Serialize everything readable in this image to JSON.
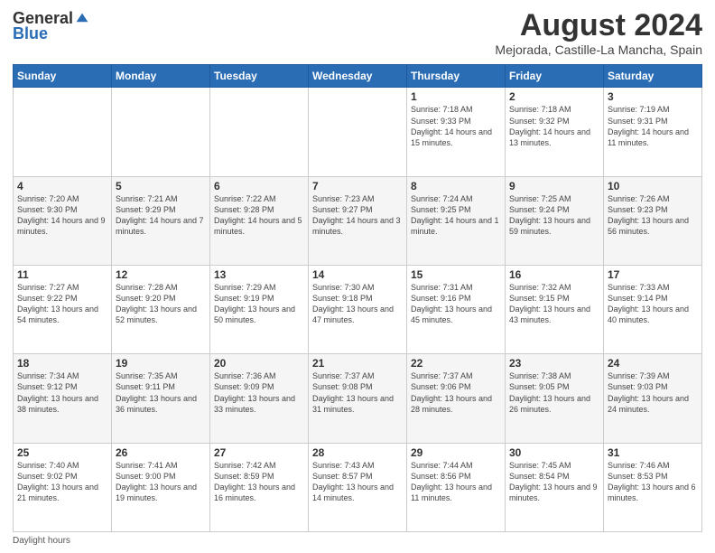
{
  "header": {
    "logo_general": "General",
    "logo_blue": "Blue",
    "title": "August 2024",
    "location": "Mejorada, Castille-La Mancha, Spain"
  },
  "days_of_week": [
    "Sunday",
    "Monday",
    "Tuesday",
    "Wednesday",
    "Thursday",
    "Friday",
    "Saturday"
  ],
  "weeks": [
    [
      {
        "day": "",
        "info": ""
      },
      {
        "day": "",
        "info": ""
      },
      {
        "day": "",
        "info": ""
      },
      {
        "day": "",
        "info": ""
      },
      {
        "day": "1",
        "info": "Sunrise: 7:18 AM\nSunset: 9:33 PM\nDaylight: 14 hours and 15 minutes."
      },
      {
        "day": "2",
        "info": "Sunrise: 7:18 AM\nSunset: 9:32 PM\nDaylight: 14 hours and 13 minutes."
      },
      {
        "day": "3",
        "info": "Sunrise: 7:19 AM\nSunset: 9:31 PM\nDaylight: 14 hours and 11 minutes."
      }
    ],
    [
      {
        "day": "4",
        "info": "Sunrise: 7:20 AM\nSunset: 9:30 PM\nDaylight: 14 hours and 9 minutes."
      },
      {
        "day": "5",
        "info": "Sunrise: 7:21 AM\nSunset: 9:29 PM\nDaylight: 14 hours and 7 minutes."
      },
      {
        "day": "6",
        "info": "Sunrise: 7:22 AM\nSunset: 9:28 PM\nDaylight: 14 hours and 5 minutes."
      },
      {
        "day": "7",
        "info": "Sunrise: 7:23 AM\nSunset: 9:27 PM\nDaylight: 14 hours and 3 minutes."
      },
      {
        "day": "8",
        "info": "Sunrise: 7:24 AM\nSunset: 9:25 PM\nDaylight: 14 hours and 1 minute."
      },
      {
        "day": "9",
        "info": "Sunrise: 7:25 AM\nSunset: 9:24 PM\nDaylight: 13 hours and 59 minutes."
      },
      {
        "day": "10",
        "info": "Sunrise: 7:26 AM\nSunset: 9:23 PM\nDaylight: 13 hours and 56 minutes."
      }
    ],
    [
      {
        "day": "11",
        "info": "Sunrise: 7:27 AM\nSunset: 9:22 PM\nDaylight: 13 hours and 54 minutes."
      },
      {
        "day": "12",
        "info": "Sunrise: 7:28 AM\nSunset: 9:20 PM\nDaylight: 13 hours and 52 minutes."
      },
      {
        "day": "13",
        "info": "Sunrise: 7:29 AM\nSunset: 9:19 PM\nDaylight: 13 hours and 50 minutes."
      },
      {
        "day": "14",
        "info": "Sunrise: 7:30 AM\nSunset: 9:18 PM\nDaylight: 13 hours and 47 minutes."
      },
      {
        "day": "15",
        "info": "Sunrise: 7:31 AM\nSunset: 9:16 PM\nDaylight: 13 hours and 45 minutes."
      },
      {
        "day": "16",
        "info": "Sunrise: 7:32 AM\nSunset: 9:15 PM\nDaylight: 13 hours and 43 minutes."
      },
      {
        "day": "17",
        "info": "Sunrise: 7:33 AM\nSunset: 9:14 PM\nDaylight: 13 hours and 40 minutes."
      }
    ],
    [
      {
        "day": "18",
        "info": "Sunrise: 7:34 AM\nSunset: 9:12 PM\nDaylight: 13 hours and 38 minutes."
      },
      {
        "day": "19",
        "info": "Sunrise: 7:35 AM\nSunset: 9:11 PM\nDaylight: 13 hours and 36 minutes."
      },
      {
        "day": "20",
        "info": "Sunrise: 7:36 AM\nSunset: 9:09 PM\nDaylight: 13 hours and 33 minutes."
      },
      {
        "day": "21",
        "info": "Sunrise: 7:37 AM\nSunset: 9:08 PM\nDaylight: 13 hours and 31 minutes."
      },
      {
        "day": "22",
        "info": "Sunrise: 7:37 AM\nSunset: 9:06 PM\nDaylight: 13 hours and 28 minutes."
      },
      {
        "day": "23",
        "info": "Sunrise: 7:38 AM\nSunset: 9:05 PM\nDaylight: 13 hours and 26 minutes."
      },
      {
        "day": "24",
        "info": "Sunrise: 7:39 AM\nSunset: 9:03 PM\nDaylight: 13 hours and 24 minutes."
      }
    ],
    [
      {
        "day": "25",
        "info": "Sunrise: 7:40 AM\nSunset: 9:02 PM\nDaylight: 13 hours and 21 minutes."
      },
      {
        "day": "26",
        "info": "Sunrise: 7:41 AM\nSunset: 9:00 PM\nDaylight: 13 hours and 19 minutes."
      },
      {
        "day": "27",
        "info": "Sunrise: 7:42 AM\nSunset: 8:59 PM\nDaylight: 13 hours and 16 minutes."
      },
      {
        "day": "28",
        "info": "Sunrise: 7:43 AM\nSunset: 8:57 PM\nDaylight: 13 hours and 14 minutes."
      },
      {
        "day": "29",
        "info": "Sunrise: 7:44 AM\nSunset: 8:56 PM\nDaylight: 13 hours and 11 minutes."
      },
      {
        "day": "30",
        "info": "Sunrise: 7:45 AM\nSunset: 8:54 PM\nDaylight: 13 hours and 9 minutes."
      },
      {
        "day": "31",
        "info": "Sunrise: 7:46 AM\nSunset: 8:53 PM\nDaylight: 13 hours and 6 minutes."
      }
    ]
  ],
  "footer": {
    "daylight_label": "Daylight hours"
  }
}
